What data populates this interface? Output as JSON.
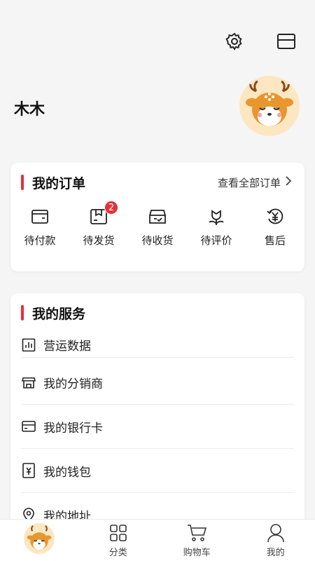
{
  "profile": {
    "name": "木木"
  },
  "orders": {
    "title": "我的订单",
    "view_all": "查看全部订单",
    "items": [
      {
        "label": "待付款",
        "icon": "wallet-card-icon"
      },
      {
        "label": "待发货",
        "icon": "box-icon",
        "badge": "2"
      },
      {
        "label": "待收货",
        "icon": "inbox-check-icon"
      },
      {
        "label": "待评价",
        "icon": "flower-icon"
      },
      {
        "label": "售后",
        "icon": "yuan-return-icon"
      }
    ]
  },
  "services": {
    "title": "我的服务",
    "items": [
      {
        "label": "营运数据",
        "icon": "chart-icon"
      },
      {
        "label": "我的分销商",
        "icon": "store-icon"
      },
      {
        "label": "我的银行卡",
        "icon": "bank-card-icon"
      },
      {
        "label": "我的钱包",
        "icon": "wallet-icon"
      },
      {
        "label": "我的地址",
        "icon": "location-icon"
      }
    ]
  },
  "tabbar": {
    "items": [
      {
        "label": "",
        "icon": "deer-avatar"
      },
      {
        "label": "分类",
        "icon": "grid-icon"
      },
      {
        "label": "购物车",
        "icon": "cart-icon"
      },
      {
        "label": "我的",
        "icon": "user-icon"
      }
    ]
  },
  "colors": {
    "accent": "#e5303a",
    "avatar_bg": "#fce7c2",
    "deer": "#e8962e"
  }
}
